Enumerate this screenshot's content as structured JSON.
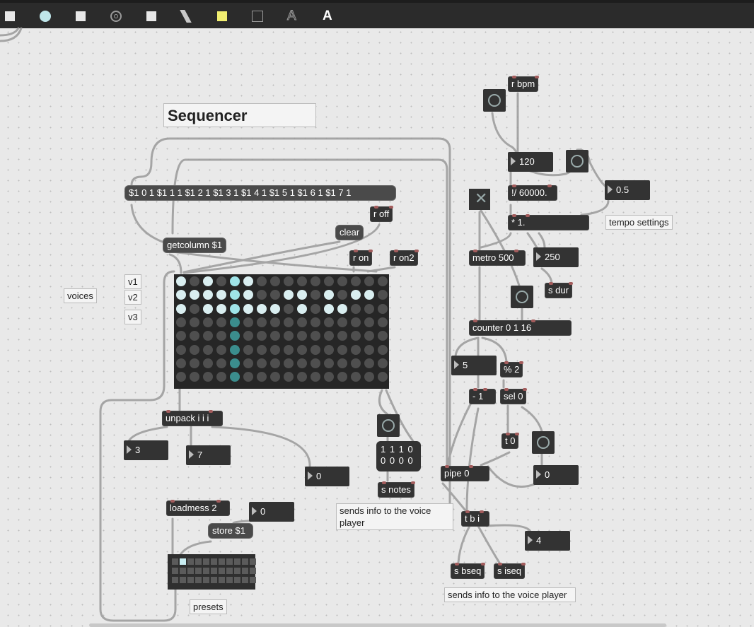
{
  "toolbar": {
    "items": [
      "button-square-icon",
      "object-circle-icon",
      "message-square-icon",
      "dial-icon",
      "comment-square-icon",
      "slash-icon",
      "yellow-panel-icon",
      "outline-square-icon",
      "text-outline-icon",
      "text-bold-icon"
    ],
    "text_outline": "A",
    "text_bold": "A"
  },
  "comments": {
    "title": "Sequencer",
    "voices": "voices",
    "v1": "v1",
    "v2": "v2",
    "v3": "v3",
    "tempo_settings": "tempo settings",
    "sends_info_1": "sends info to the voice player",
    "sends_info_2": "sends info to the voice player",
    "presets": "presets"
  },
  "objects": {
    "dollar_msg": "$1 0 1 $1 1 1 $1 2 1 $1 3 1 $1 4 1 $1 5 1 $1 6 1 $1 7 1",
    "getcolumn": "getcolumn $1",
    "clear": "clear",
    "r_off": "r off",
    "r_on": "r on",
    "r_on2": "r on2",
    "unpack": "unpack i i i",
    "loadmess": "loadmess 2",
    "store": "store $1",
    "s_notes": "s notes",
    "r_bpm": "r bpm",
    "div": "!/ 60000.",
    "mul": "* 1.",
    "metro": "metro 500",
    "counter": "counter 0 1 16",
    "mod": "% 2",
    "minus": "- 1",
    "sel": "sel 0",
    "t0": "t 0",
    "pipe": "pipe 0",
    "tbi": "t b i",
    "s_bseq": "s bseq",
    "s_iseq": "s iseq",
    "s_dur": "s dur"
  },
  "numbers": {
    "n3": "3",
    "n7": "7",
    "n0a": "0",
    "n0b": "0",
    "bpm": "120",
    "half": "0.5",
    "dur": "250",
    "five": "5",
    "pipe_out": "0",
    "four": "4"
  },
  "bitmatrix": {
    "row1": "1 1 1 0",
    "row2": "0 0 0 0"
  },
  "matrix": {
    "columns": 16,
    "rows": 8,
    "highlight_column": 4,
    "on": [
      [
        0,
        0
      ],
      [
        2,
        0
      ],
      [
        4,
        0
      ],
      [
        5,
        0
      ],
      [
        0,
        1
      ],
      [
        1,
        1
      ],
      [
        2,
        1
      ],
      [
        3,
        1
      ],
      [
        4,
        1
      ],
      [
        5,
        1
      ],
      [
        8,
        1
      ],
      [
        9,
        1
      ],
      [
        11,
        1
      ],
      [
        13,
        1
      ],
      [
        14,
        1
      ],
      [
        0,
        2
      ],
      [
        2,
        2
      ],
      [
        3,
        2
      ],
      [
        4,
        2
      ],
      [
        5,
        2
      ],
      [
        6,
        2
      ],
      [
        7,
        2
      ],
      [
        9,
        2
      ],
      [
        11,
        2
      ],
      [
        12,
        2
      ]
    ]
  },
  "presets": {
    "columns": 11,
    "rows": 3,
    "selected": 1
  },
  "colors": {
    "object_bg": "#333333",
    "canvas": "#e9e9e9",
    "cell_on": "#d9eef0",
    "cell_highlight": "#3b8d8d"
  }
}
